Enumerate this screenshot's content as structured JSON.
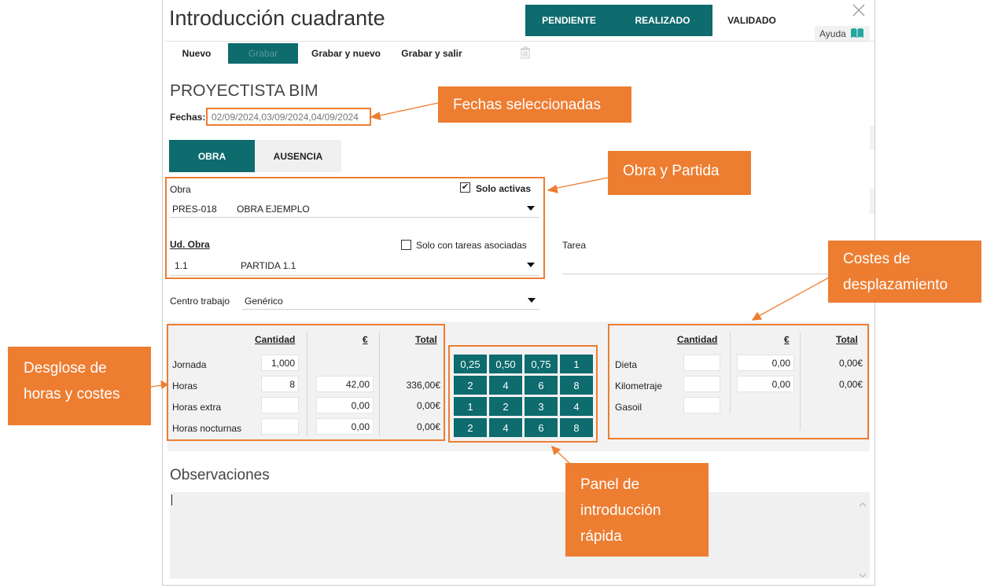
{
  "window": {
    "title": "Introducción cuadrante",
    "statuses": [
      {
        "label": "PENDIENTE",
        "active": true
      },
      {
        "label": "REALIZADO",
        "active": true
      },
      {
        "label": "VALIDADO",
        "active": false
      }
    ],
    "help_label": "Ayuda"
  },
  "toolbar": {
    "new_label": "Nuevo",
    "save_label": "Grabar",
    "save_new_label": "Grabar y nuevo",
    "save_exit_label": "Grabar y salir"
  },
  "form": {
    "profile": "PROYECTISTA BIM",
    "dates_label": "Fechas:",
    "dates_value": "02/09/2024,03/09/2024,04/09/2024",
    "tabs": [
      "OBRA",
      "AUSENCIA"
    ],
    "obra_label": "Obra",
    "solo_activas_label": "Solo activas",
    "solo_activas_checked": true,
    "obra_code": "PRES-018",
    "obra_name": "OBRA EJEMPLO",
    "ud_obra_label": "Ud. Obra",
    "solo_tareas_label": "Solo con tareas asociadas",
    "solo_tareas_checked": false,
    "tarea_label": "Tarea",
    "ud_code": "1.1",
    "ud_name": "PARTIDA 1.1",
    "centro_label": "Centro trabajo",
    "centro_value": "Genérico"
  },
  "hours": {
    "headers": {
      "cantidad": "Cantidad",
      "euro": "€",
      "total": "Total"
    },
    "rows": [
      {
        "label": "Jornada",
        "cantidad": "1,000",
        "euro": "",
        "total": ""
      },
      {
        "label": "Horas",
        "cantidad": "8",
        "euro": "42,00",
        "total": "336,00€"
      },
      {
        "label": "Horas extra",
        "cantidad": "",
        "euro": "0,00",
        "total": "0,00€"
      },
      {
        "label": "Horas nocturnas",
        "cantidad": "",
        "euro": "0,00",
        "total": "0,00€"
      }
    ]
  },
  "quick_panel": [
    [
      "0,25",
      "0,50",
      "0,75",
      "1"
    ],
    [
      "2",
      "4",
      "6",
      "8"
    ],
    [
      "1",
      "2",
      "3",
      "4"
    ],
    [
      "2",
      "4",
      "6",
      "8"
    ]
  ],
  "travel": {
    "headers": {
      "cantidad": "Cantidad",
      "euro": "€",
      "total": "Total"
    },
    "rows": [
      {
        "label": "Dieta",
        "cantidad": "",
        "euro": "0,00",
        "total": "0,00€"
      },
      {
        "label": "Kilometraje",
        "cantidad": "",
        "euro": "0,00",
        "total": "0,00€"
      },
      {
        "label": "Gasoil",
        "cantidad": "",
        "euro": "",
        "total": ""
      }
    ]
  },
  "observations": {
    "label": "Observaciones",
    "value": ""
  },
  "callouts": {
    "fechas": "Fechas seleccionadas",
    "obra": "Obra y Partida",
    "costes_1": "Costes de",
    "costes_2": "desplazamiento",
    "desglose_1": "Desglose de",
    "desglose_2": "horas y costes",
    "panel_1": "Panel de",
    "panel_2": "introducción",
    "panel_3": "rápida"
  },
  "colors": {
    "teal": "#0e6b6e",
    "callout_orange": "#ed7d31"
  }
}
